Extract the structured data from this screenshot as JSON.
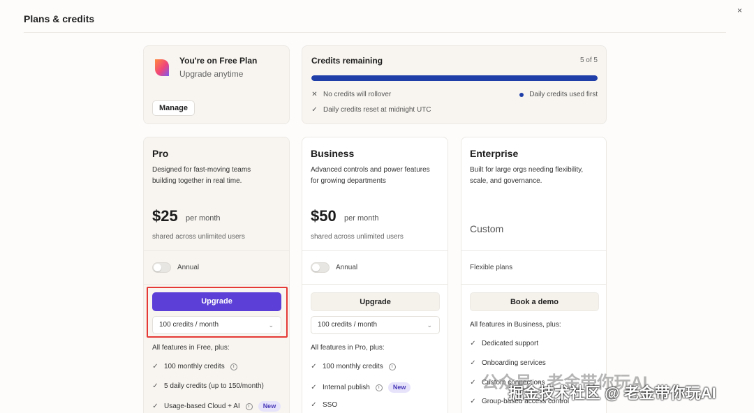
{
  "dialog": {
    "title": "Plans & credits",
    "close_icon": "×"
  },
  "free_plan": {
    "name": "You're on Free Plan",
    "subtitle": "Upgrade anytime",
    "manage_label": "Manage",
    "logo_icon": "heart-logo-icon"
  },
  "credits": {
    "title": "Credits remaining",
    "count": "5 of 5",
    "progress": 1.0,
    "bar_color": "#1f3ea8",
    "rollover": "No credits will rollover",
    "used_first": "Daily credits used first",
    "reset": "Daily credits reset at midnight UTC"
  },
  "plans": [
    {
      "name": "Pro",
      "description": "Designed for fast-moving teams building together in real time.",
      "price": "$25",
      "per": "per month",
      "shared": "shared across unlimited users",
      "toggle_label": "Annual",
      "button": "Upgrade",
      "select": "100 credits / month",
      "features_heading": "All features in Free, plus:",
      "features": [
        {
          "text": "100 monthly credits",
          "info": true
        },
        {
          "text": "5 daily credits (up to 150/month)"
        },
        {
          "text": "Usage-based Cloud + AI",
          "info": true,
          "badge": "New"
        }
      ]
    },
    {
      "name": "Business",
      "description": "Advanced controls and power features for growing departments",
      "price": "$50",
      "per": "per month",
      "shared": "shared across unlimited users",
      "toggle_label": "Annual",
      "button": "Upgrade",
      "select": "100 credits / month",
      "features_heading": "All features in Pro, plus:",
      "features": [
        {
          "text": "100 monthly credits",
          "info": true
        },
        {
          "text": "Internal publish",
          "info": true,
          "badge": "New"
        },
        {
          "text": "SSO"
        }
      ]
    },
    {
      "name": "Enterprise",
      "description": "Built for large orgs needing flexibility, scale, and governance.",
      "price": "Custom",
      "flexible": "Flexible plans",
      "button": "Book a demo",
      "features_heading": "All features in Business, plus:",
      "features": [
        {
          "text": "Dedicated support"
        },
        {
          "text": "Onboarding services"
        },
        {
          "text": "Custom connections"
        },
        {
          "text": "Group-based access control"
        }
      ]
    }
  ],
  "colors": {
    "primary_button": "#5b3fd6",
    "highlight_box": "#e53935",
    "badge_bg": "#e6e3fb"
  },
  "watermark": {
    "line1": "公众号 · 老金带你玩AI",
    "line2": "掘金技术社区 @ 老金带你玩AI"
  }
}
